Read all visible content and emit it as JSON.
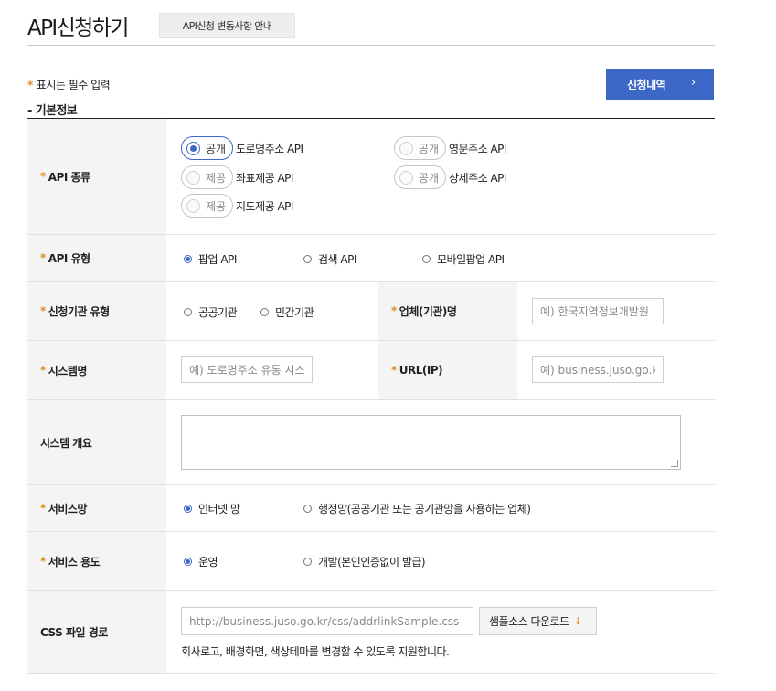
{
  "header": {
    "title": "API신청하기",
    "notice_button": "API신청 변동사항 안내"
  },
  "required_note": {
    "star": "*",
    "text": "표시는 필수 입력"
  },
  "history_button": {
    "label": "신청내역",
    "chevron": "›"
  },
  "section_title": "- 기본정보",
  "form": {
    "api_type": {
      "star": "*",
      "label": "API 종류",
      "options": [
        {
          "status": "공개",
          "label": "도로명주소 API",
          "selected": true
        },
        {
          "status": "공개",
          "label": "영문주소 API",
          "selected": false
        },
        {
          "status": "제공",
          "label": "좌표제공 API",
          "selected": false
        },
        {
          "status": "공개",
          "label": "상세주소 API",
          "selected": false
        },
        {
          "status": "제공",
          "label": "지도제공 API",
          "selected": false
        }
      ]
    },
    "api_kind": {
      "star": "*",
      "label": "API 유형",
      "options": [
        {
          "label": "팝업 API",
          "selected": true
        },
        {
          "label": "검색 API",
          "selected": false
        },
        {
          "label": "모바일팝업 API",
          "selected": false
        }
      ]
    },
    "org_type": {
      "star": "*",
      "label": "신청기관 유형",
      "options": [
        {
          "label": "공공기관",
          "selected": false
        },
        {
          "label": "민간기관",
          "selected": false
        }
      ]
    },
    "company_name": {
      "star": "*",
      "label": "업체(기관)명",
      "placeholder": "예) 한국지역정보개발원"
    },
    "system_name": {
      "star": "*",
      "label": "시스템명",
      "placeholder": "예) 도로명주소 유통 시스"
    },
    "url": {
      "star": "*",
      "label": "URL(IP)",
      "placeholder": "예) business.juso.go.kr"
    },
    "system_overview": {
      "label": "시스템 개요",
      "value": ""
    },
    "service_network": {
      "star": "*",
      "label": "서비스망",
      "options": [
        {
          "label": "인터넷 망",
          "selected": true
        },
        {
          "label": "행정망(공공기관 또는 공기관망을 사용하는 업체)",
          "selected": false
        }
      ]
    },
    "service_purpose": {
      "star": "*",
      "label": "서비스 용도",
      "options": [
        {
          "label": "운영",
          "selected": true
        },
        {
          "label": "개발(본인인증없이 발급)",
          "selected": false
        }
      ]
    },
    "css_path": {
      "label": "CSS 파일 경로",
      "placeholder": "http://business.juso.go.kr/css/addrlinkSample.css",
      "download_label": "샘플소스 다운로드",
      "download_icon": "↓",
      "description": "회사로고, 배경화면, 색상테마를 변경할 수 있도록 지원합니다."
    }
  },
  "colors": {
    "accent": "#3e68c8",
    "required_star": "#e08a1e",
    "header_cell_bg": "#f4f4f4"
  }
}
